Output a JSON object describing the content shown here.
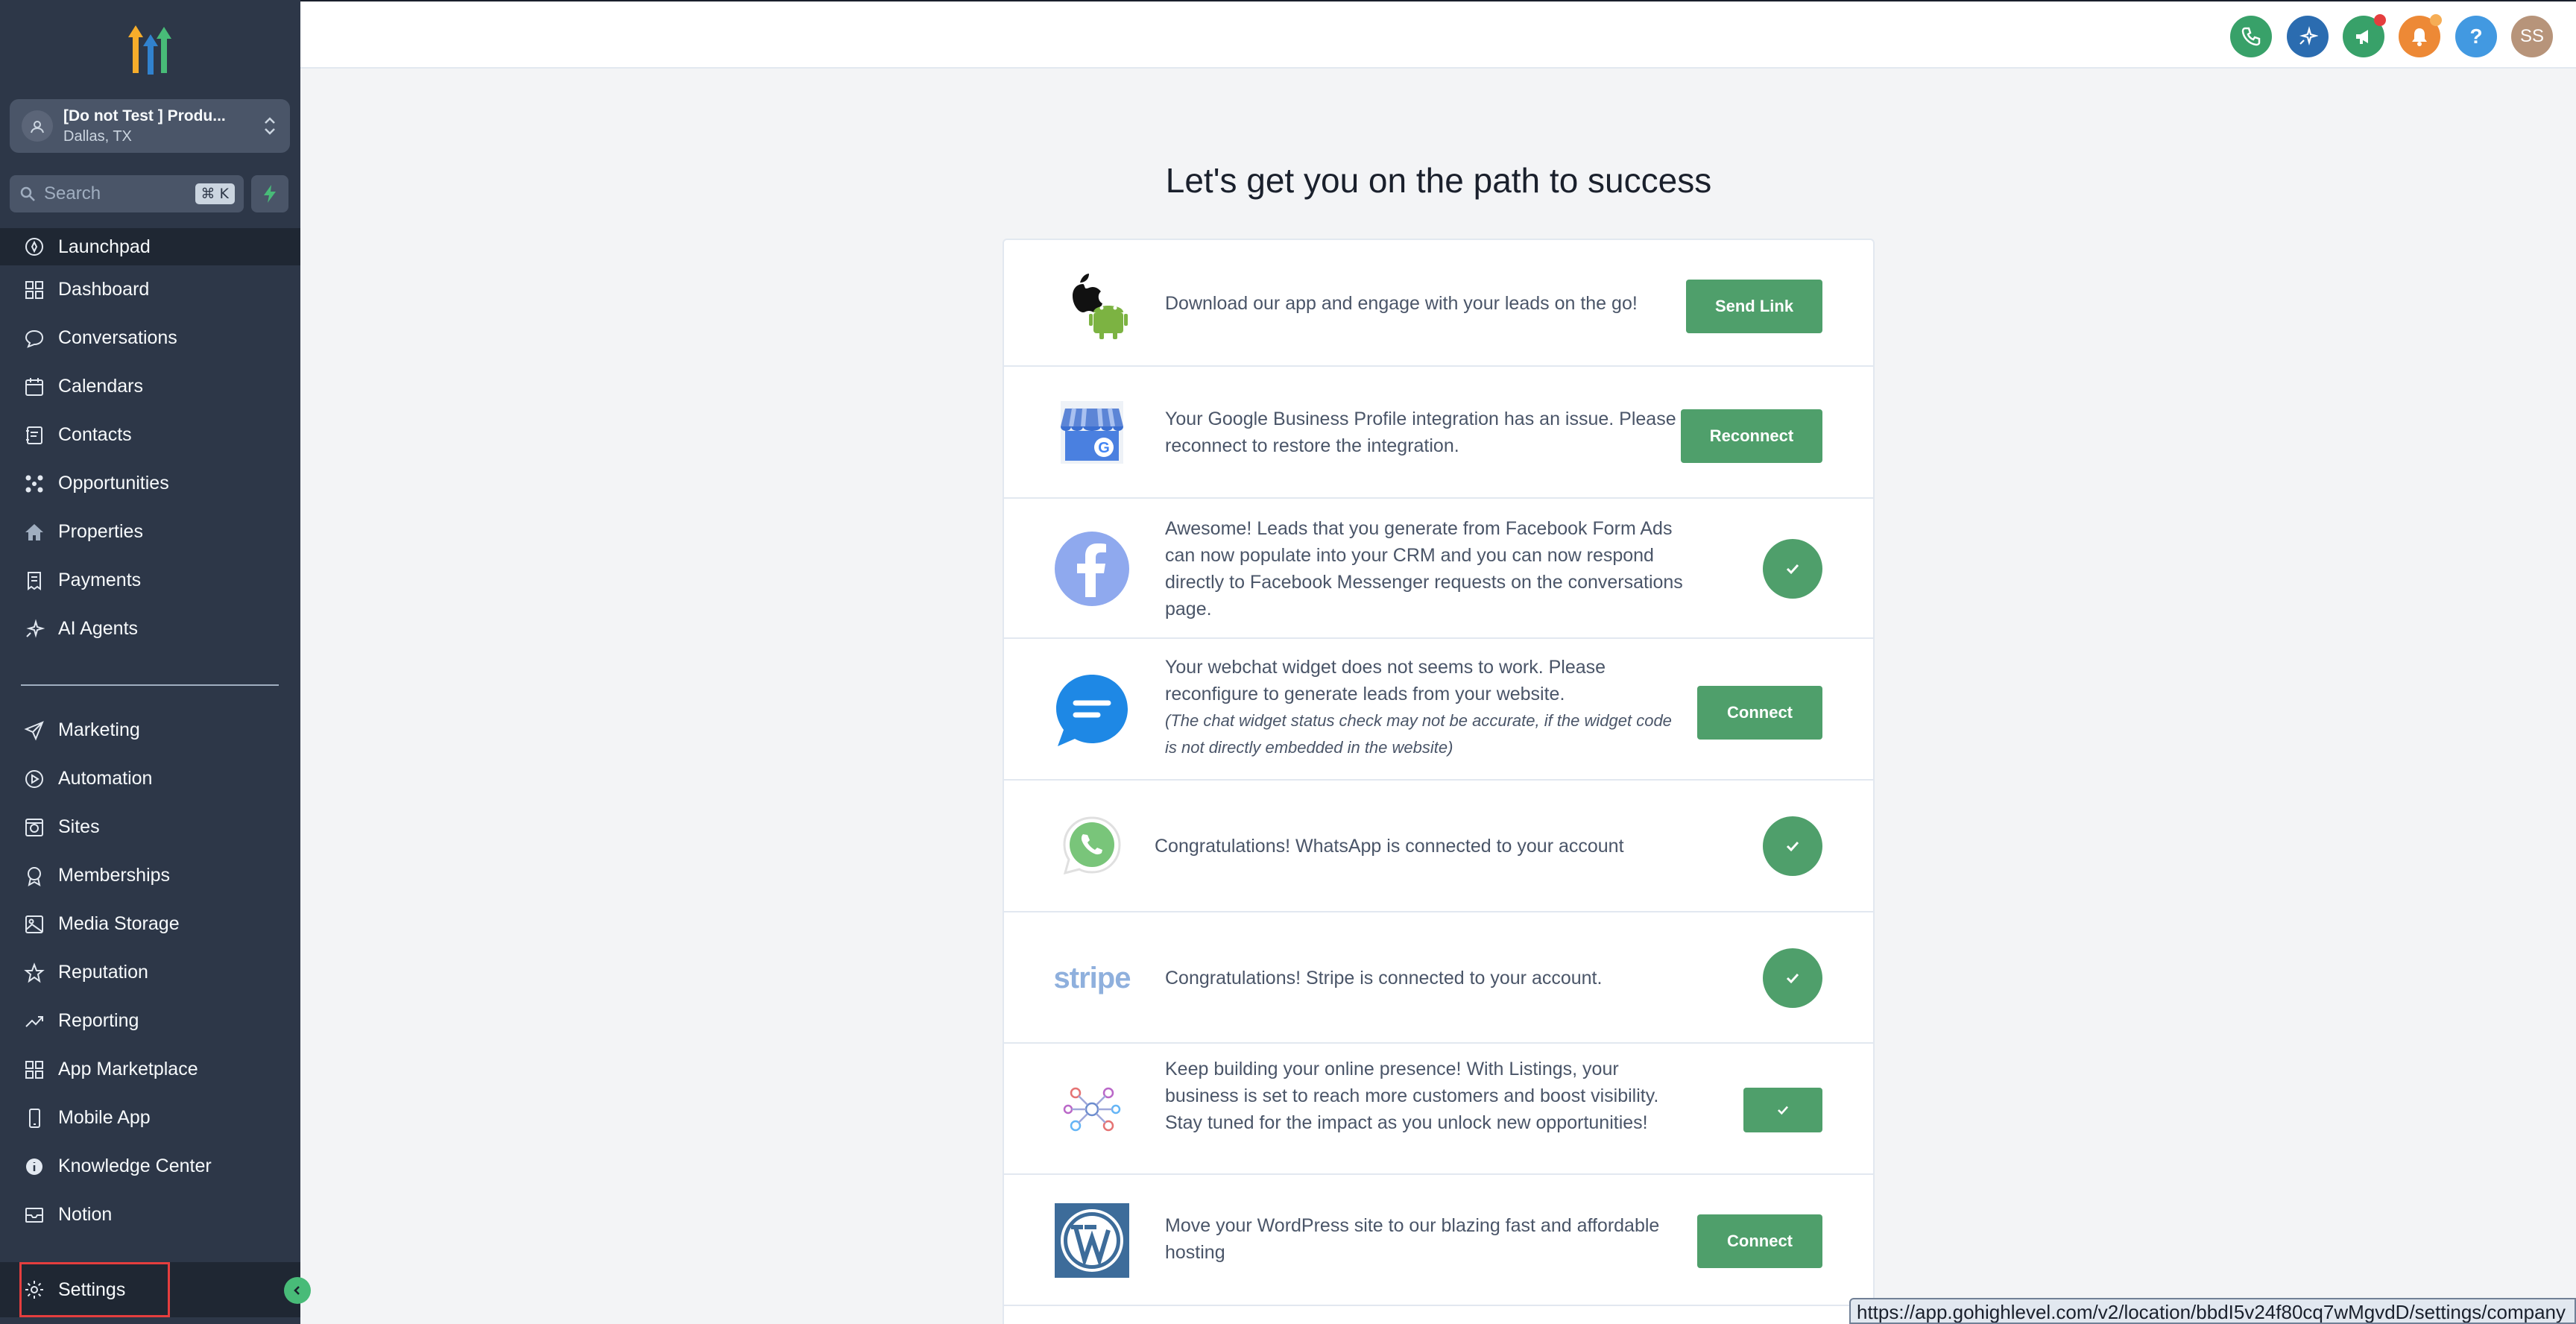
{
  "account": {
    "name": "[Do not Test ] Produ...",
    "location": "Dallas, TX"
  },
  "search": {
    "placeholder": "Search",
    "shortcut": "⌘ K"
  },
  "sidebar": {
    "items": [
      {
        "label": "Launchpad",
        "icon": "rocket-icon"
      },
      {
        "label": "Dashboard",
        "icon": "grid-icon"
      },
      {
        "label": "Conversations",
        "icon": "chat-bubble-icon"
      },
      {
        "label": "Calendars",
        "icon": "calendar-icon"
      },
      {
        "label": "Contacts",
        "icon": "contact-book-icon"
      },
      {
        "label": "Opportunities",
        "icon": "network-icon"
      },
      {
        "label": "Properties",
        "icon": "home-icon"
      },
      {
        "label": "Payments",
        "icon": "receipt-icon"
      },
      {
        "label": "AI Agents",
        "icon": "sparkle-icon"
      }
    ],
    "items2": [
      {
        "label": "Marketing",
        "icon": "send-icon"
      },
      {
        "label": "Automation",
        "icon": "automation-icon"
      },
      {
        "label": "Sites",
        "icon": "globe-icon"
      },
      {
        "label": "Memberships",
        "icon": "award-icon"
      },
      {
        "label": "Media Storage",
        "icon": "image-icon"
      },
      {
        "label": "Reputation",
        "icon": "star-icon"
      },
      {
        "label": "Reporting",
        "icon": "trend-icon"
      },
      {
        "label": "App Marketplace",
        "icon": "apps-icon"
      },
      {
        "label": "Mobile App",
        "icon": "phone-icon"
      },
      {
        "label": "Knowledge Center",
        "icon": "info-icon"
      },
      {
        "label": "Notion",
        "icon": "mail-icon"
      }
    ],
    "settings": {
      "label": "Settings",
      "icon": "gear-icon"
    }
  },
  "topbar": {
    "avatar": "SS",
    "help": "?"
  },
  "page": {
    "heading": "Let's get you on the path to success",
    "rows": [
      {
        "text": "Download our app and engage with your leads on the go!",
        "action": "Send Link"
      },
      {
        "text": "Your Google Business Profile integration has an issue. Please reconnect to restore the integration.",
        "action": "Reconnect"
      },
      {
        "text": "Awesome! Leads that you generate from Facebook Form Ads can now populate into your CRM and you can now respond directly to Facebook Messenger requests on the conversations page."
      },
      {
        "text": "Your webchat widget does not seems to work. Please reconfigure to generate leads from your website.",
        "note": "(The chat widget status check may not be accurate, if the widget code is not directly embedded in the website)",
        "action": "Connect"
      },
      {
        "text": "Congratulations! WhatsApp is connected to your account"
      },
      {
        "text": "Congratulations! Stripe is connected to your account.",
        "logo": "stripe"
      },
      {
        "text": "Keep building your online presence! With Listings, your business is set to reach more customers and boost visibility. Stay tuned for the impact as you unlock new opportunities!"
      },
      {
        "text": "Move your WordPress site to our blazing fast and affordable hosting",
        "action": "Connect"
      }
    ]
  },
  "status_url": "https://app.gohighlevel.com/v2/location/bbdI5v24f80cq7wMgvdD/settings/company"
}
